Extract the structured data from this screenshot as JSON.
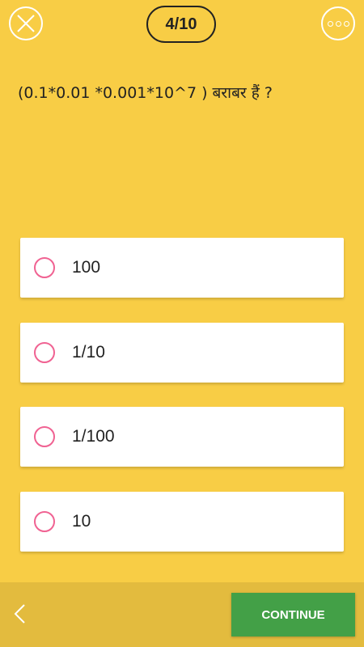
{
  "header": {
    "counter": "4/10",
    "close_icon": "close-icon",
    "more_icon": "more-options-icon"
  },
  "question": {
    "text": "(0.1*0.01 *0.001*10^7 ) बराबर हैं ?"
  },
  "options": [
    {
      "label": "100"
    },
    {
      "label": "1/10"
    },
    {
      "label": "1/100"
    },
    {
      "label": "10"
    }
  ],
  "footer": {
    "back_icon": "chevron-left-icon",
    "continue_label": "CONTINUE"
  },
  "colors": {
    "background": "#F8CD45",
    "bottom_bar": "#E3BB3E",
    "radio": "#F06292",
    "continue": "#43A047"
  }
}
